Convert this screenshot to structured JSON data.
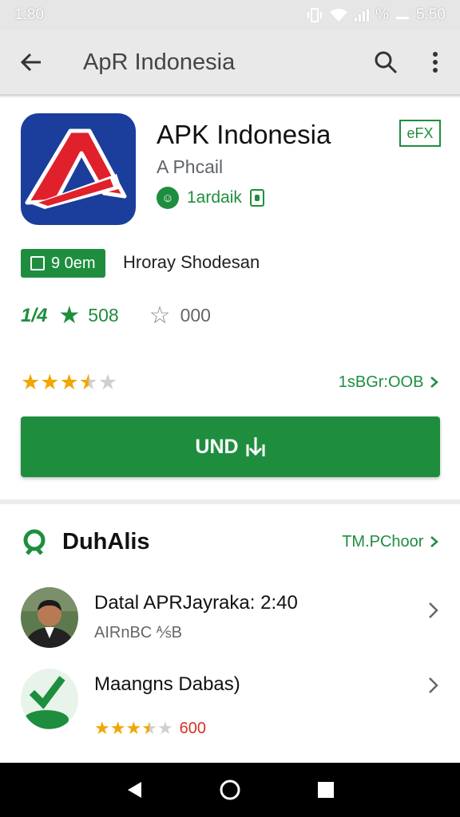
{
  "status": {
    "time": "1:80",
    "battery": "%",
    "right_time": "5:50"
  },
  "appbar": {
    "title": "ApR Indonesia",
    "back_icon": "arrow-back-icon",
    "search_icon": "search-icon",
    "more_icon": "more-vert-icon"
  },
  "app": {
    "name": "APK Indonesia",
    "developer": "A Phcail",
    "badge_label": "1ardaik",
    "tag": "eFX",
    "chip_label": "9 0em",
    "chip_desc": "Hroray Shodesan",
    "stat_a": "1/4",
    "stat_b": "508",
    "stat_c": "000",
    "rating_link": "1sBGr:OOB",
    "rating_stars": 3.5,
    "install_label": "UND"
  },
  "section": {
    "title": "DuhAlis",
    "link": "TM.PChoor",
    "items": [
      {
        "title": "Datal APRJayraka: 2:40",
        "subtitle": "AIRnBC ⅍B"
      },
      {
        "title": "Maangns Dabas)",
        "rating_stars": 3.5,
        "rating_text": "600"
      }
    ]
  },
  "colors": {
    "accent": "#1e8e3e",
    "star": "#f2a600",
    "icon_bg": "#1b3e9c",
    "icon_red": "#e0212b"
  }
}
